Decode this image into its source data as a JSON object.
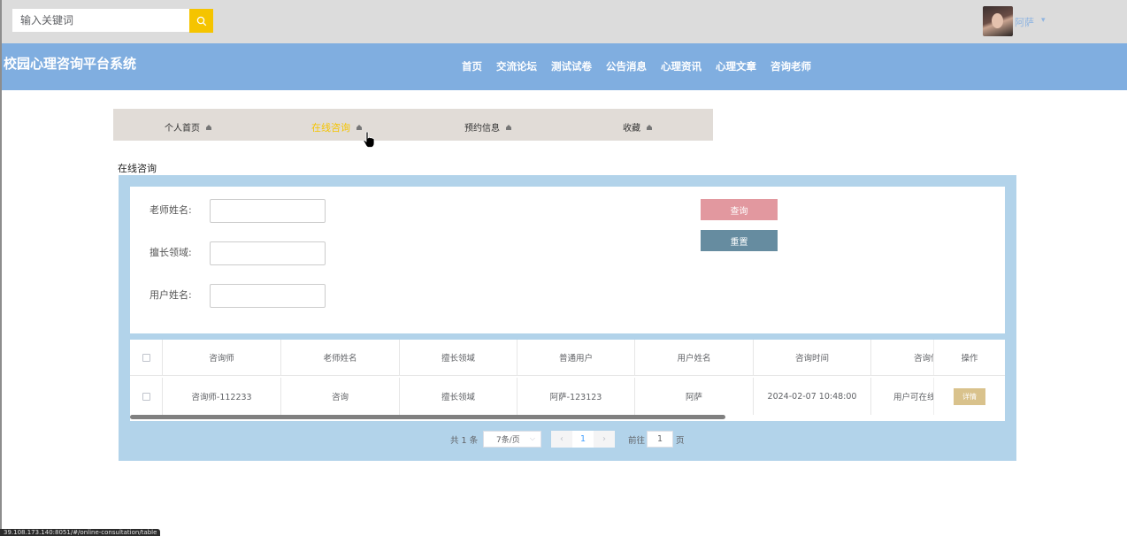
{
  "header": {
    "search_placeholder": "输入关键词",
    "username": "阿萨"
  },
  "navbar": {
    "site_title": "校园心理咨询平台系统",
    "links": [
      "首页",
      "交流论坛",
      "测试试卷",
      "公告消息",
      "心理资讯",
      "心理文章",
      "咨询老师"
    ]
  },
  "user_menu": {
    "items": [
      "个人首页",
      "在线咨询",
      "预约信息",
      "收藏"
    ],
    "active": "在线咨询"
  },
  "page": {
    "section_title": "在线咨询"
  },
  "search_form": {
    "teacher_name_label": "老师姓名:",
    "specialty_label": "擅长领域:",
    "user_name_label": "用户姓名:",
    "query_button": "查询",
    "reset_button": "重置"
  },
  "table": {
    "columns": [
      "咨询师",
      "老师姓名",
      "擅长领域",
      "普通用户",
      "用户姓名",
      "咨询时间",
      "咨询信",
      "操作"
    ],
    "rows": [
      {
        "counselor": "咨询师-112233",
        "teacher_name": "咨询",
        "specialty": "擅长领域",
        "regular_user": "阿萨-123123",
        "user_name": "阿萨",
        "consult_time": "2024-02-07 10:48:00",
        "consult_info": "用户可在线",
        "action": "详情"
      }
    ]
  },
  "pagination": {
    "total_text": "共 1 条",
    "page_size": "7条/页",
    "current_page": "1",
    "goto_prefix": "前往",
    "goto_value": "1",
    "goto_suffix": "页"
  },
  "status_bar": {
    "url": "39.108.173.140:8051/#/online-consultation/table"
  },
  "colors": {
    "nav_bg": "#80aee0",
    "accent_yellow": "#f5c400",
    "panel_bg": "#b2d3ea",
    "query_btn": "#e2989f",
    "reset_btn": "#668ca0",
    "detail_btn": "#d9c28c"
  }
}
